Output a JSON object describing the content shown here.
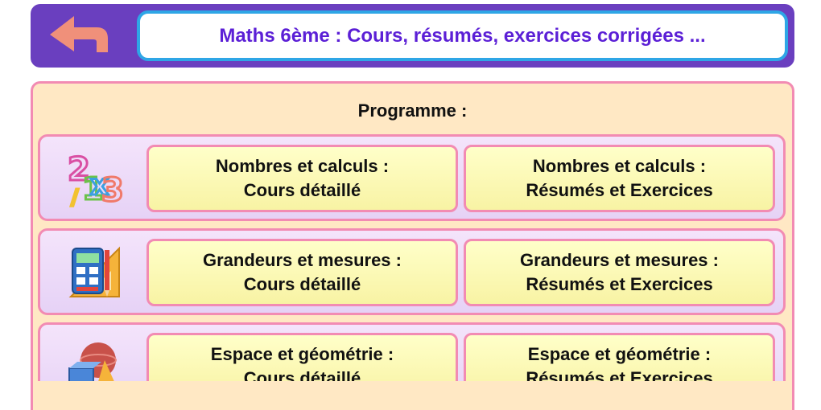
{
  "header": {
    "title": "Maths 6ème : Cours, résumés, exercices corrigées ..."
  },
  "main": {
    "section_title": "Programme :",
    "rows": [
      {
        "icon": "numbers-icon",
        "left": {
          "line1": "Nombres et calculs :",
          "line2": "Cours détaillé"
        },
        "right": {
          "line1": "Nombres et calculs :",
          "line2": "Résumés et Exercices"
        }
      },
      {
        "icon": "calculator-ruler-icon",
        "left": {
          "line1": "Grandeurs et mesures :",
          "line2": "Cours détaillé"
        },
        "right": {
          "line1": "Grandeurs et mesures :",
          "line2": "Résumés et Exercices"
        }
      },
      {
        "icon": "geometry-shapes-icon",
        "left": {
          "line1": "Espace et géométrie :",
          "line2": "Cours détaillé"
        },
        "right": {
          "line1": "Espace et géométrie :",
          "line2": "Résumés et Exercices"
        }
      }
    ]
  },
  "colors": {
    "header_bg": "#6a3fbf",
    "title_text": "#5b1fd6",
    "title_border": "#2ea6e6",
    "back_arrow": "#f0907a",
    "panel_bg": "#ffe8c4",
    "border_pink": "#f28bb3",
    "button_yellow": "#ffffc9"
  }
}
